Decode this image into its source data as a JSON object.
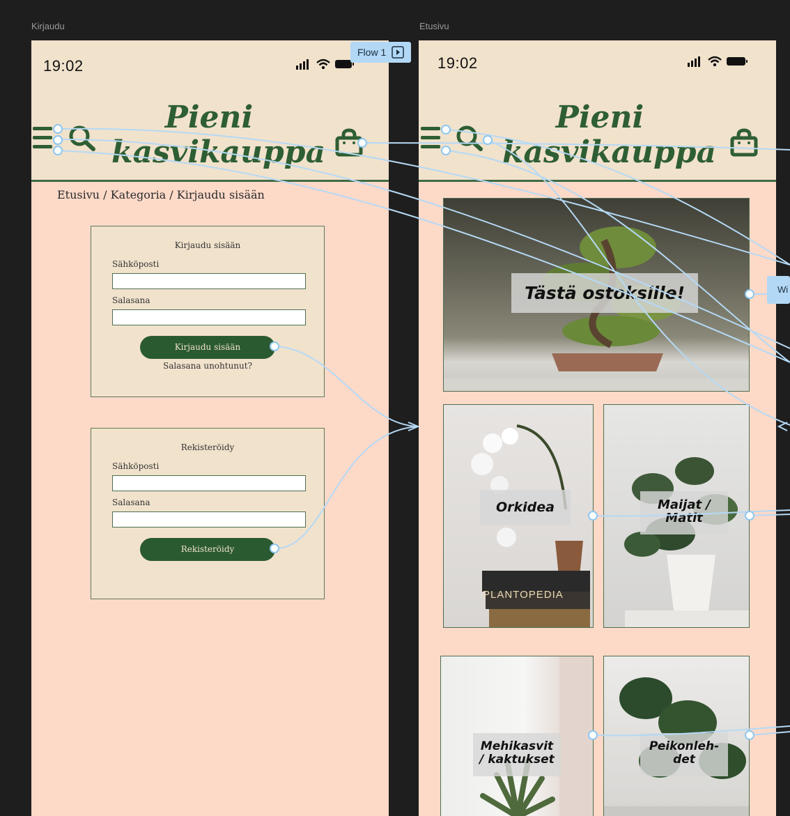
{
  "frames": {
    "left": {
      "label": "Kirjaudu"
    },
    "right": {
      "label": "Etusivu"
    }
  },
  "flow": {
    "label": "Flow 1",
    "partial_label": "Wi"
  },
  "status": {
    "time_left": "19:02",
    "time_right": "19:02"
  },
  "logo": {
    "line1": "Pieni",
    "line2": "kasvikauppa"
  },
  "breadcrumb": "Etusivu / Kategoria / Kirjaudu sisään",
  "login": {
    "title": "Kirjaudu sisään",
    "email_label": "Sähköposti",
    "password_label": "Salasana",
    "button": "Kirjaudu sisään",
    "forgot": "Salasana unohtunut?"
  },
  "register": {
    "title": "Rekisteröidy",
    "email_label": "Sähköposti",
    "password_label": "Salasana",
    "button": "Rekisteröidy"
  },
  "home": {
    "hero": "Tästä ostoksille!",
    "categories": {
      "orchid": "Orkidea",
      "herbs_1": "Maijat /",
      "herbs_2": "Matit",
      "succulents_1": "Mehikasvit",
      "succulents_2": "/ kaktukset",
      "monstera_1": "Peikonleh-",
      "monstera_2": "det"
    },
    "book_title": "PLANTOPEDIA"
  },
  "colors": {
    "canvas": "#1e1e1e",
    "page": "#fdd9c8",
    "header": "#f1e2cc",
    "brand_green": "#2e5e33",
    "prototype_blue": "#b2d8f5"
  }
}
